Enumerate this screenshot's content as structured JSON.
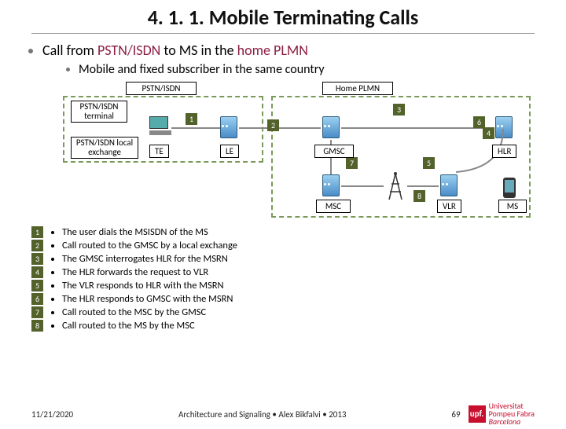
{
  "title": "4. 1. 1. Mobile Terminating Calls",
  "main_bullet_prefix": "Call from ",
  "main_bullet_accent1": "PSTN/ISDN",
  "main_bullet_mid": " to MS in the ",
  "main_bullet_accent2": "home PLMN",
  "sub_bullet": "Mobile and fixed subscriber in the same country",
  "pstn_header": "PSTN/ISDN",
  "home_header": "Home PLMN",
  "label_terminal": "PSTN/ISDN terminal",
  "label_local_exchange": "PSTN/ISDN local exchange",
  "comp_te": "TE",
  "comp_le": "LE",
  "comp_gmsc": "GMSC",
  "comp_hlr": "HLR",
  "comp_vlr": "VLR",
  "comp_msc": "MSC",
  "comp_ms": "MS",
  "steps": {
    "1": "The user dials the MSISDN of the MS",
    "2": "Call routed to the GMSC by a local exchange",
    "3": "The GMSC interrogates HLR for the MSRN",
    "4": "The HLR forwards the request to VLR",
    "5": "The VLR responds to HLR with the MSRN",
    "6": "The HLR responds to GMSC with the MSRN",
    "7": "Call routed to the MSC by the GMSC",
    "8": "Call routed to the MS by the MSC"
  },
  "footer_date": "11/21/2020",
  "footer_center": "Architecture and Signaling • Alex Bikfalvi • 2013",
  "footer_page": "69",
  "logo_mark": "upf.",
  "logo_line1": "Universitat",
  "logo_line2": "Pompeu Fabra",
  "logo_line3": "Barcelona"
}
